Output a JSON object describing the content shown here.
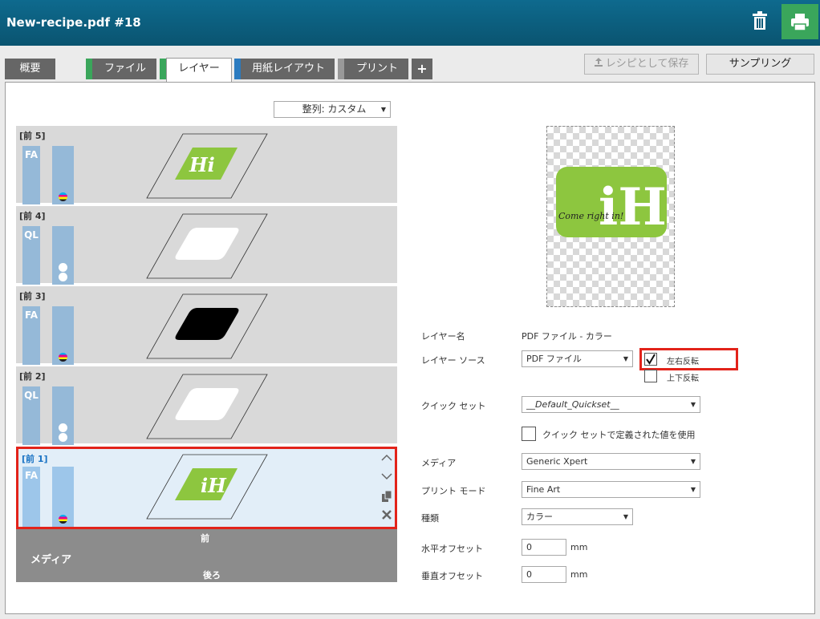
{
  "window": {
    "title": "New-recipe.pdf #18"
  },
  "icons": {
    "trash": "trash-icon",
    "print": "print-icon",
    "upload": "upload-icon",
    "plus": "plus-icon"
  },
  "colors": {
    "accent_green": "#3aa65b",
    "titlebar": "#0a5470",
    "layer_blue": "#95b9d8",
    "highlight_red": "#e2231a",
    "logo_green": "#8dc63f"
  },
  "tabs": [
    {
      "label": "概要",
      "stripe": ""
    },
    {
      "label": "ファイル",
      "stripe": "#3aa65b"
    },
    {
      "label": "レイヤー",
      "stripe": "#3aa65b",
      "active": true
    },
    {
      "label": "用紙レイアウト",
      "stripe": "#2b7bc0"
    },
    {
      "label": "プリント",
      "stripe": "#999999"
    },
    {
      "label": "+",
      "stripe": ""
    }
  ],
  "toolbar": {
    "save_as_recipe": "レシピとして保存",
    "sampling": "サンプリング"
  },
  "sort": {
    "value": "整列: カスタム"
  },
  "layers": [
    {
      "label": "[前 5]",
      "code": "FA",
      "marker": "cmyk"
    },
    {
      "label": "[前 4]",
      "code": "QL",
      "marker": "white"
    },
    {
      "label": "[前 3]",
      "code": "FA",
      "marker": "cmyk"
    },
    {
      "label": "[前 2]",
      "code": "QL",
      "marker": "white"
    },
    {
      "label": "[前 1]",
      "code": "FA",
      "marker": "cmyk",
      "selected": true
    }
  ],
  "logo": {
    "text": "Hi",
    "script": "Come right in!"
  },
  "media_bar": {
    "label": "メディア",
    "front": "前",
    "back": "後ろ"
  },
  "form": {
    "layer_name_label": "レイヤー名",
    "layer_name_value": "PDF ファイル - カラー",
    "source_label": "レイヤー ソース",
    "source_value": "PDF ファイル",
    "mirror_h_label": "左右反転",
    "mirror_h_checked": true,
    "mirror_v_label": "上下反転",
    "mirror_v_checked": false,
    "quickset_label": "クイック セット",
    "quickset_value": "__Default_Quickset__",
    "use_quickset_label": "クイック セットで定義された値を使用",
    "media_label": "メディア",
    "media_value": "Generic Xpert",
    "printmode_label": "プリント モード",
    "printmode_value": "Fine Art",
    "type_label": "種類",
    "type_value": "カラー",
    "h_offset_label": "水平オフセット",
    "h_offset_value": "0",
    "v_offset_label": "垂直オフセット",
    "v_offset_value": "0",
    "unit": "mm"
  }
}
